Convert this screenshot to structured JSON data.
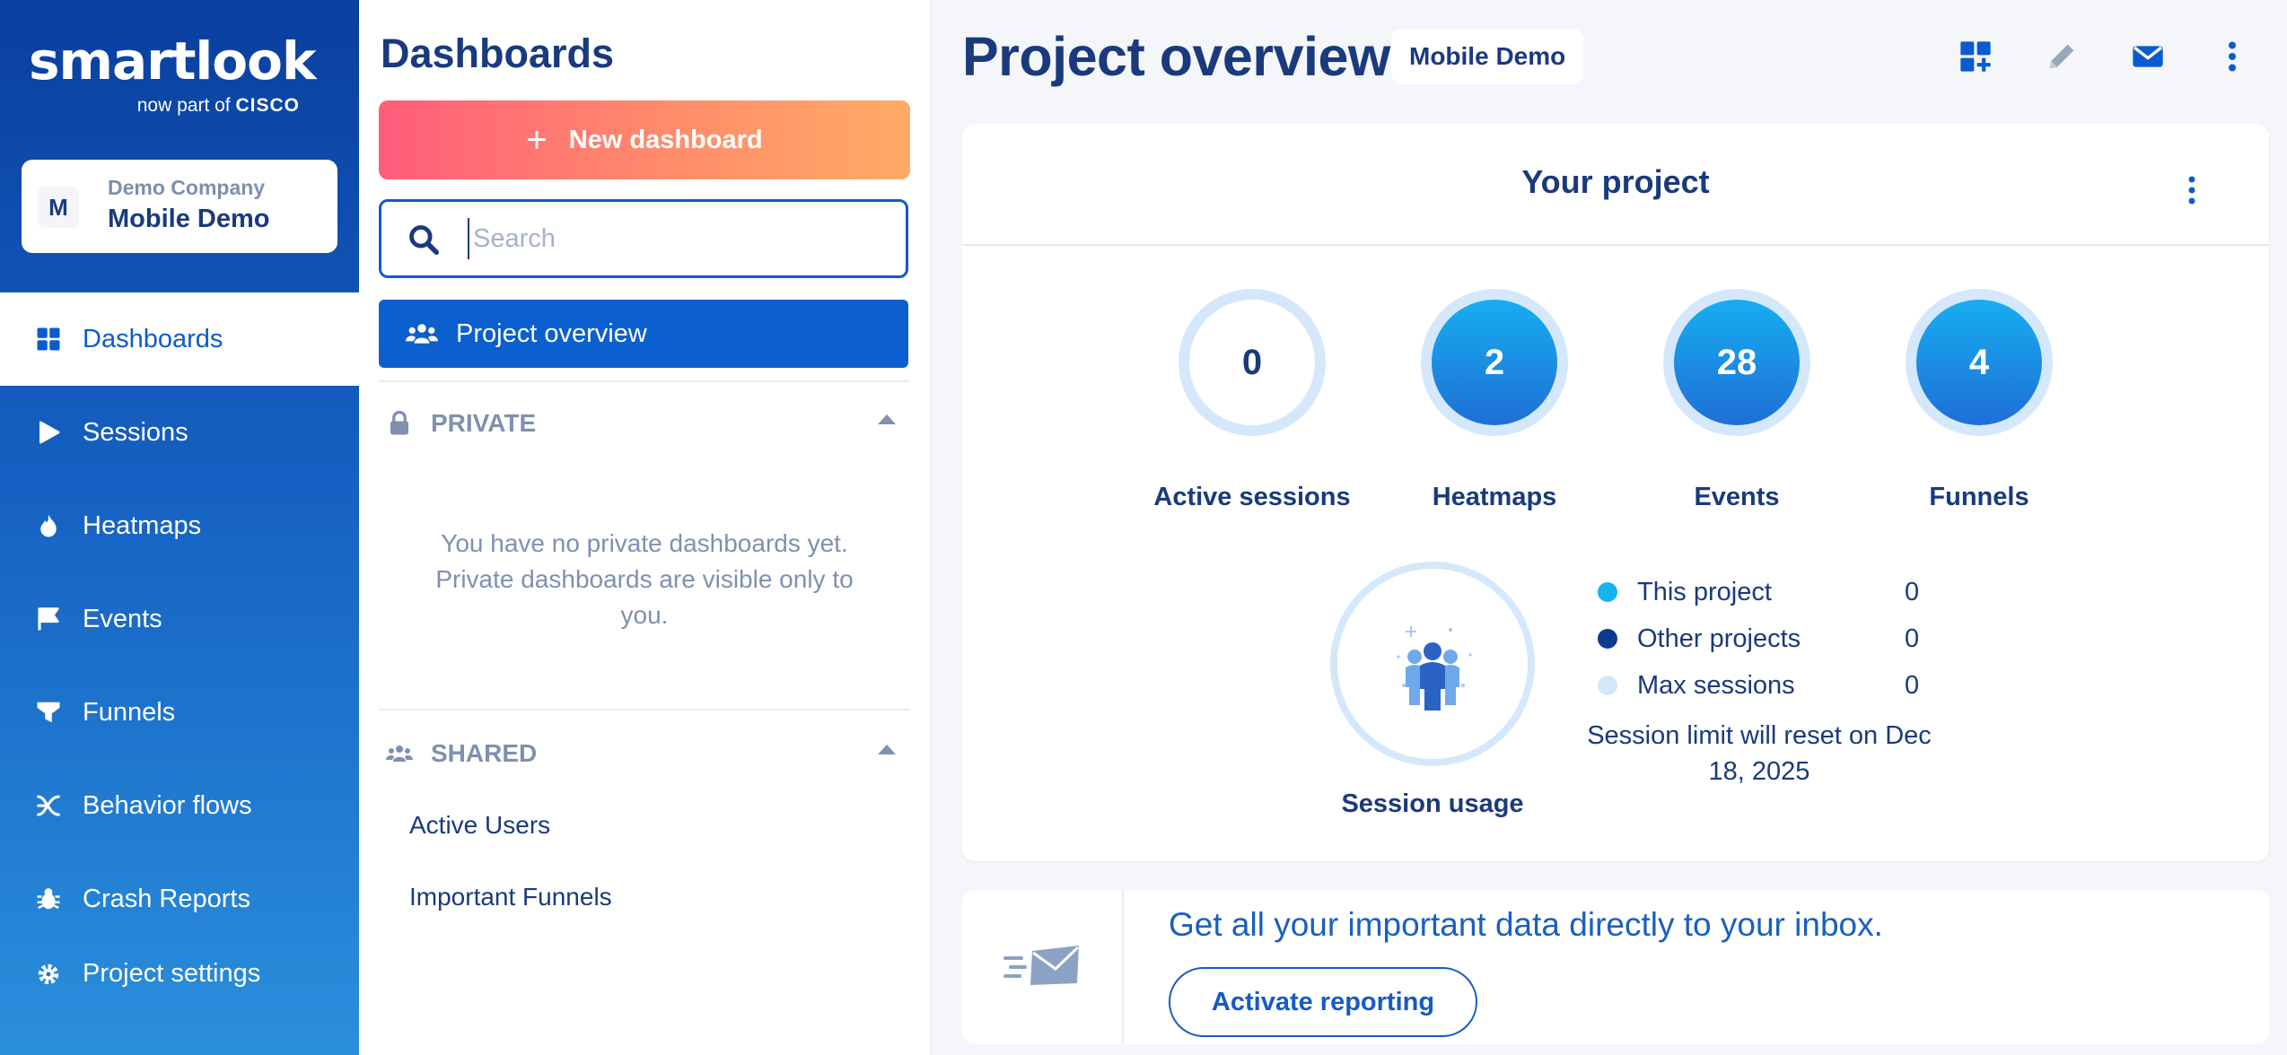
{
  "brand": {
    "logo_text": "smartlook",
    "tagline_prefix": "now part of",
    "tagline_brand": "CISCO"
  },
  "company": {
    "initial": "M",
    "name": "Demo Company",
    "project": "Mobile Demo"
  },
  "nav": {
    "items": [
      {
        "label": "Dashboards",
        "icon": "grid-icon",
        "active": true
      },
      {
        "label": "Sessions",
        "icon": "play-icon"
      },
      {
        "label": "Heatmaps",
        "icon": "flame-icon"
      },
      {
        "label": "Events",
        "icon": "flag-icon"
      },
      {
        "label": "Funnels",
        "icon": "funnel-icon"
      },
      {
        "label": "Behavior flows",
        "icon": "flows-icon"
      },
      {
        "label": "Crash Reports",
        "icon": "bug-icon"
      },
      {
        "label": "Project settings",
        "icon": "gear-icon"
      }
    ]
  },
  "dashboards_panel": {
    "title": "Dashboards",
    "new_button": "New dashboard",
    "search_placeholder": "Search",
    "project_overview": "Project overview",
    "private": {
      "header": "PRIVATE",
      "empty_message": "You have no private dashboards yet. Private dashboards are visible only to you."
    },
    "shared": {
      "header": "SHARED",
      "items": [
        "Active Users",
        "Important Funnels"
      ]
    }
  },
  "main": {
    "title": "Project overview",
    "project_badge": "Mobile Demo",
    "toolbar": [
      "add-widget-icon",
      "pencil-icon",
      "envelope-icon",
      "more-vertical-icon"
    ],
    "card": {
      "title": "Your project",
      "stats": [
        {
          "value": "0",
          "label": "Active sessions"
        },
        {
          "value": "2",
          "label": "Heatmaps"
        },
        {
          "value": "28",
          "label": "Events"
        },
        {
          "value": "4",
          "label": "Funnels"
        }
      ],
      "usage_label": "Session usage",
      "legend": [
        {
          "label": "This project",
          "value": "0",
          "color": "#14b4f0"
        },
        {
          "label": "Other projects",
          "value": "0",
          "color": "#0b3a8f"
        },
        {
          "label": "Max sessions",
          "value": "0",
          "color": "#d5e8fb"
        }
      ],
      "reset_text": "Session limit will reset on Dec 18, 2025"
    },
    "promo": {
      "text": "Get all your important data directly to your inbox.",
      "button": "Activate reporting"
    }
  },
  "colors": {
    "nav_top": "#0a3f9e",
    "nav_bottom": "#2a8fdc",
    "primary": "#0b5fce",
    "title": "#1a3a7d",
    "new_button_from": "#ff5d7a",
    "new_button_to": "#ffab66"
  }
}
